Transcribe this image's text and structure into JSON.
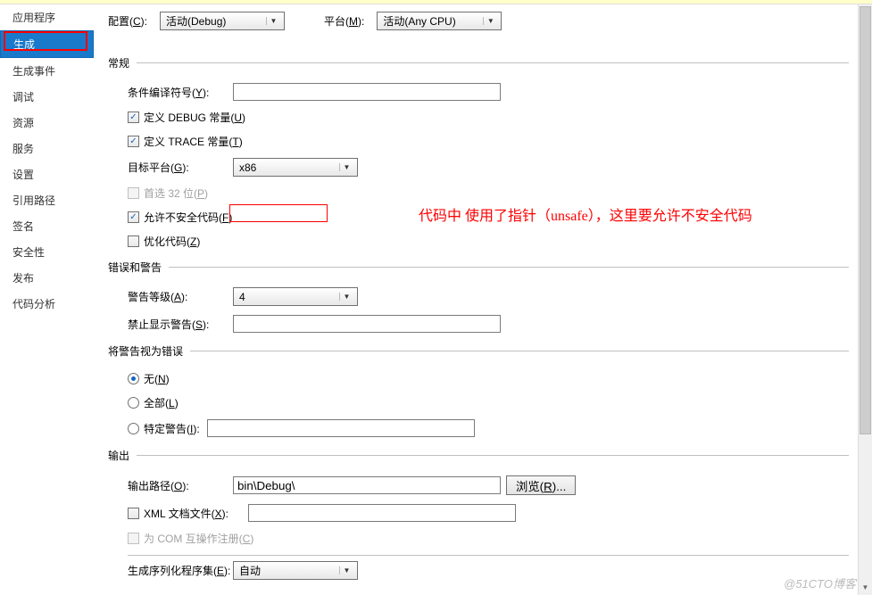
{
  "sidebar": {
    "items": [
      {
        "label": "应用程序"
      },
      {
        "label": "生成"
      },
      {
        "label": "生成事件"
      },
      {
        "label": "调试"
      },
      {
        "label": "资源"
      },
      {
        "label": "服务"
      },
      {
        "label": "设置"
      },
      {
        "label": "引用路径"
      },
      {
        "label": "签名"
      },
      {
        "label": "安全性"
      },
      {
        "label": "发布"
      },
      {
        "label": "代码分析"
      }
    ]
  },
  "toprow": {
    "config_label": "配置(C):",
    "config_value": "活动(Debug)",
    "platform_label": "平台(M):",
    "platform_value": "活动(Any CPU)"
  },
  "groups": {
    "general": "常规",
    "errors": "错误和警告",
    "treat_warn": "将警告视为错误",
    "output": "输出"
  },
  "general": {
    "cond_sym_label": "条件编译符号(Y):",
    "cond_sym_value": "",
    "define_debug": "定义 DEBUG 常量(U)",
    "define_trace": "定义 TRACE 常量(T)",
    "target_platform_label": "目标平台(G):",
    "target_platform_value": "x86",
    "prefer_32": "首选 32 位(P)",
    "allow_unsafe": "允许不安全代码(F)",
    "optimize": "优化代码(Z)"
  },
  "errors": {
    "warn_level_label": "警告等级(A):",
    "warn_level_value": "4",
    "suppress_label": "禁止显示警告(S):",
    "suppress_value": ""
  },
  "treat": {
    "none": "无(N)",
    "all": "全部(L)",
    "specific": "特定警告(I):"
  },
  "output": {
    "path_label": "输出路径(O):",
    "path_value": "bin\\Debug\\",
    "browse": "浏览(R)...",
    "xml_doc": "XML 文档文件(X):",
    "com_interop": "为 COM 互操作注册(C)",
    "serial_label": "生成序列化程序集(E):",
    "serial_value": "自动"
  },
  "annotation": "代码中 使用了指针（unsafe），这里要允许不安全代码",
  "watermark": "@51CTO博客"
}
